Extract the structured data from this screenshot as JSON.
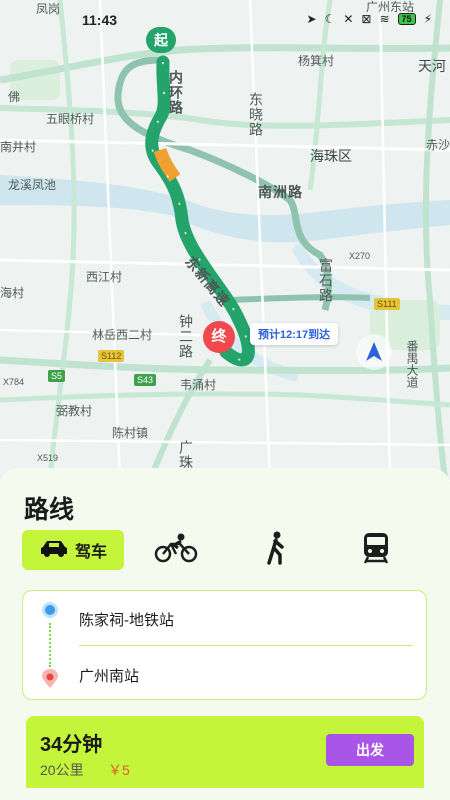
{
  "status_bar": {
    "time": "11:43",
    "battery": "75"
  },
  "map": {
    "places": {
      "fenggang": "凤岗",
      "guangzhou_east": "广州东站",
      "yangji": "杨箕村",
      "tianhe": "天河",
      "fo": "佛",
      "wuyan": "五眼桥村",
      "nanjing": "南井村",
      "haizhu": "海珠区",
      "chisha": "赤沙",
      "longxi": "龙溪凤池",
      "xijiang": "西江村",
      "hai": "海村",
      "linyue": "林岳西二村",
      "weiyong": "韦涌村",
      "pengjiao": "弼教村",
      "chencun": "陈村镇",
      "panyu": "番禺大道"
    },
    "roads": {
      "neihuan": "内环路",
      "dongxiao": "东晓路",
      "nanzhou": "南洲路",
      "dongxin": "东新高速",
      "fushi": "富石路",
      "zhonger": "钟二路",
      "guangzhu": "广珠"
    },
    "shields": {
      "x270": "X270",
      "s111": "S111",
      "s112": "S112",
      "x784": "X784",
      "s5": "S5",
      "s43": "S43",
      "x519": "X519"
    },
    "start_label": "起",
    "end_label": "终",
    "eta": "预计12:17到达",
    "colors": {
      "route": "#24a46b",
      "route_congested": "#f0a030",
      "start": "#24a46b",
      "end": "#f0494d",
      "eta_text": "#2b62d9"
    }
  },
  "panel": {
    "title": "路线",
    "modes": [
      {
        "name": "drive",
        "label": "驾车",
        "icon": "car-icon",
        "active": true
      },
      {
        "name": "bike",
        "label": "",
        "icon": "bike-icon",
        "active": false
      },
      {
        "name": "walk",
        "label": "",
        "icon": "walk-icon",
        "active": false
      },
      {
        "name": "transit",
        "label": "",
        "icon": "train-icon",
        "active": false
      }
    ],
    "from": "陈家祠-地铁站",
    "to": "广州南站",
    "result": {
      "duration": "34分钟",
      "distance": "20公里",
      "cost": "￥5",
      "go_label": "出发"
    },
    "colors": {
      "accent": "#c5f53a",
      "go_button": "#a855e8",
      "cost": "#e35d2a"
    }
  }
}
